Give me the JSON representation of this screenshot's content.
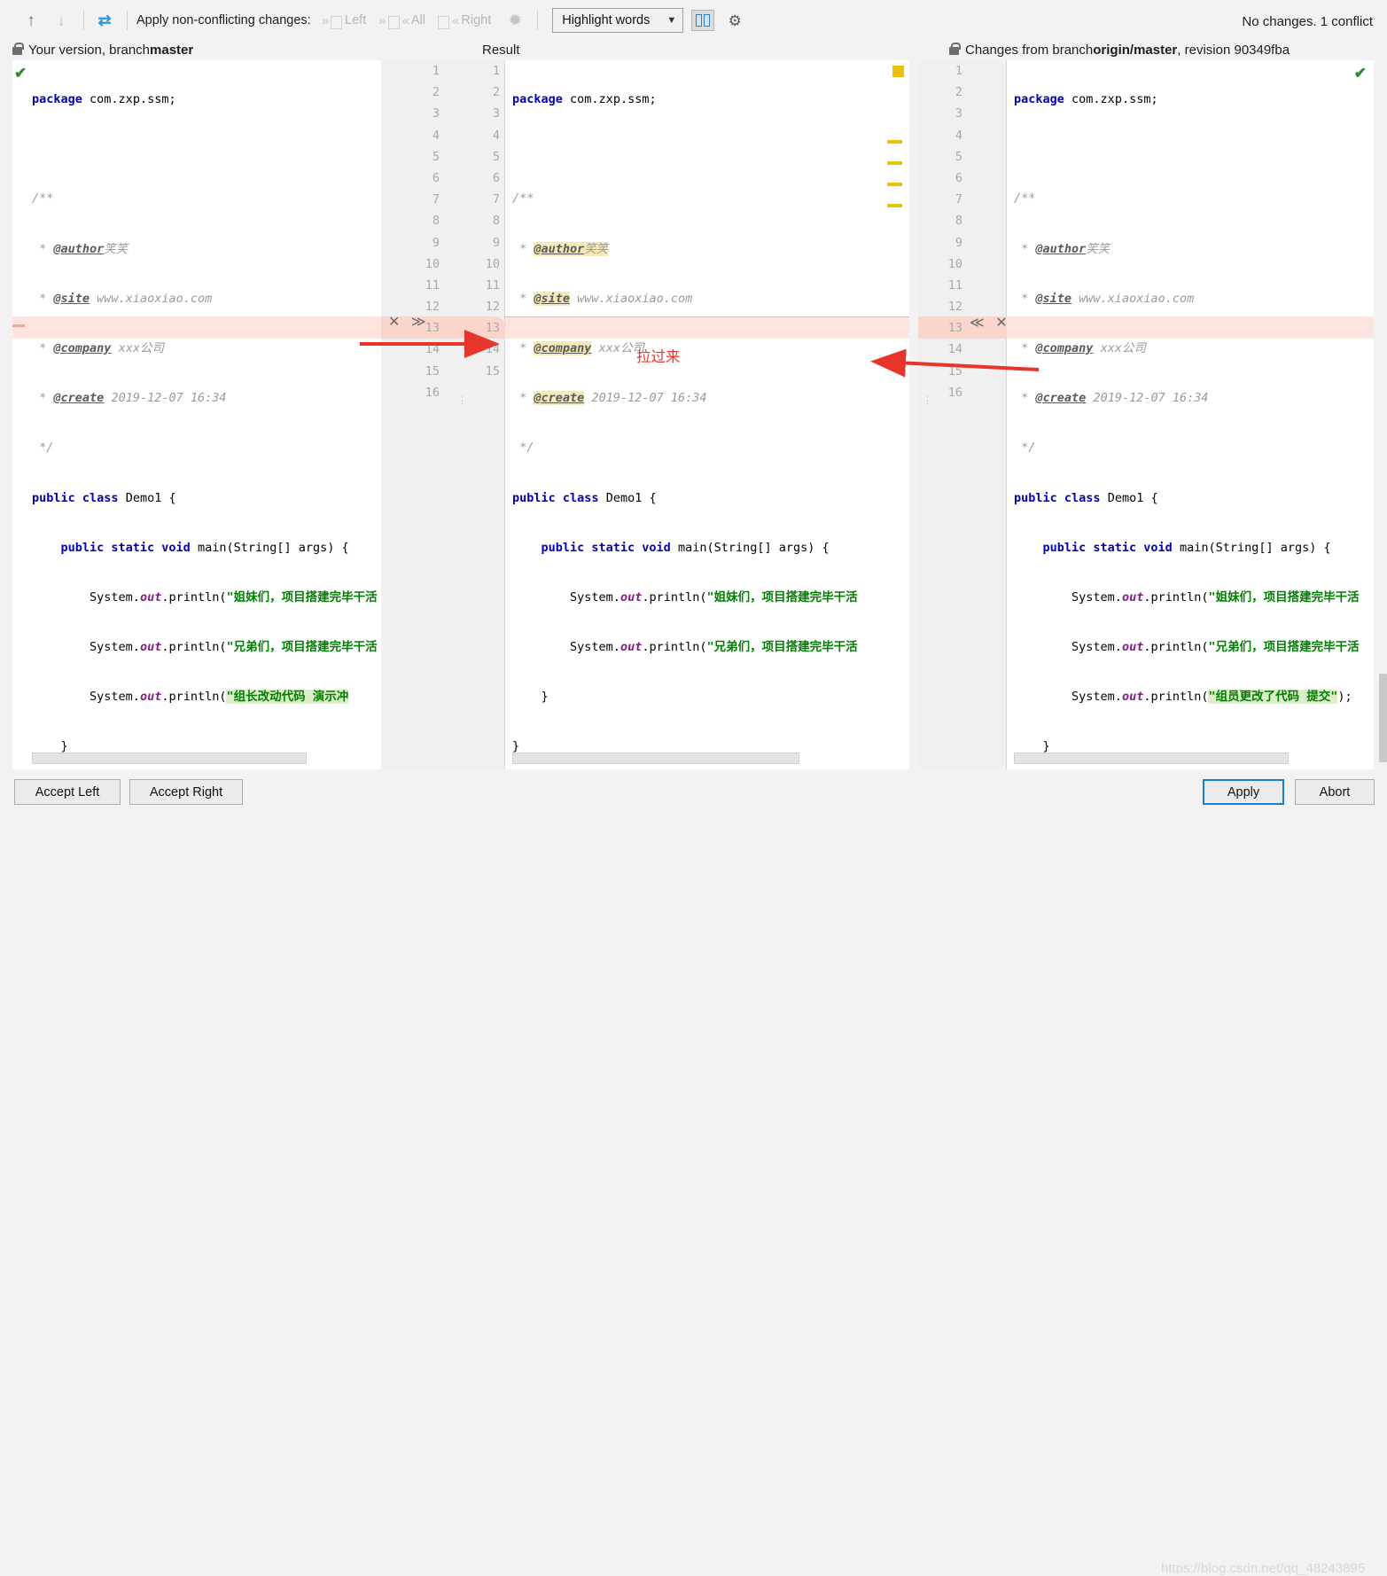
{
  "toolbar": {
    "prev_icon": "arrow-up-icon",
    "next_icon": "arrow-down-icon",
    "apply_all_icon": "apply-non-conflicting-icon",
    "apply_label": "Apply non-conflicting changes:",
    "actions": [
      {
        "label": "Left",
        "name": "apply-left",
        "enabled": false
      },
      {
        "label": "All",
        "name": "apply-all",
        "enabled": false
      },
      {
        "label": "Right",
        "name": "apply-right",
        "enabled": false
      }
    ],
    "magic_icon": "magic-wand-icon",
    "highlight_mode": "Highlight words",
    "caret_icon": "chevron-down-icon",
    "split_icon": "split-editor-icon",
    "settings_icon": "gear-icon",
    "status": "No changes. 1 conflict"
  },
  "panels": {
    "left": {
      "lock_icon": "lock-icon",
      "title_prefix": "Your version, branch ",
      "title_branch": "master",
      "ok_icon": "checkmark-icon"
    },
    "middle": {
      "title": "Result"
    },
    "right": {
      "lock_icon": "lock-icon",
      "title_prefix": "Changes from branch ",
      "title_branch": "origin/master",
      "title_suffix": ", revision 90349fba",
      "ok_icon": "checkmark-icon"
    }
  },
  "code": {
    "package_kw": "package",
    "package_name": "com.zxp.ssm;",
    "comment_open": "/**",
    "comment_close": "*/",
    "tag_author": "@author",
    "tag_author_val": "笑笑",
    "tag_site": "@site",
    "tag_site_val": "www.xiaoxiao.com",
    "tag_company": "@company",
    "tag_company_val": "xxx公司",
    "tag_create": "@create",
    "tag_create_val": "2019-12-07 16:34",
    "class_decl_kw": "public class",
    "class_decl_name": "Demo1 {",
    "main_kw": "public static void",
    "main_sig": "main(String[] args) {",
    "sysout_prefix": "System.",
    "sysout_field": "out",
    "sysout_call": ".println(",
    "str_sisters": "\"姐妹们，项目搭建完毕干活",
    "str_brothers": "\"兄弟们，项目搭建完毕干活",
    "str_leader": "\"组长改动代码 演示冲",
    "str_member": "\"组员更改了代码 提交\"",
    "str_member_tail": ");",
    "brace_inner": "}",
    "brace_outer": "}"
  },
  "line_numbers": {
    "middle_left": [
      "1",
      "2",
      "3",
      "4",
      "5",
      "6",
      "7",
      "8",
      "9",
      "10",
      "11",
      "12",
      "13",
      "14",
      "15",
      "16"
    ],
    "middle_right": [
      "1",
      "2",
      "3",
      "4",
      "5",
      "6",
      "7",
      "8",
      "9",
      "10",
      "11",
      "12",
      "13",
      "14",
      "15"
    ],
    "right": [
      "1",
      "2",
      "3",
      "4",
      "5",
      "6",
      "7",
      "8",
      "9",
      "10",
      "11",
      "12",
      "13",
      "14",
      "15",
      "16"
    ]
  },
  "gutter_actions": {
    "middle_conflict": "✕ ≫",
    "right_conflict": "≪ ✕",
    "middle_conflict_line": "13",
    "right_conflict_line": "13"
  },
  "markers": {
    "color": "#e8c007",
    "count": 5
  },
  "buttons": {
    "accept_left": "Accept Left",
    "accept_right": "Accept Right",
    "apply": "Apply",
    "abort": "Abort"
  },
  "annotations": {
    "note": "拉过来",
    "color": "#e8352a"
  },
  "watermark": "https://blog.csdn.net/qq_48243895"
}
